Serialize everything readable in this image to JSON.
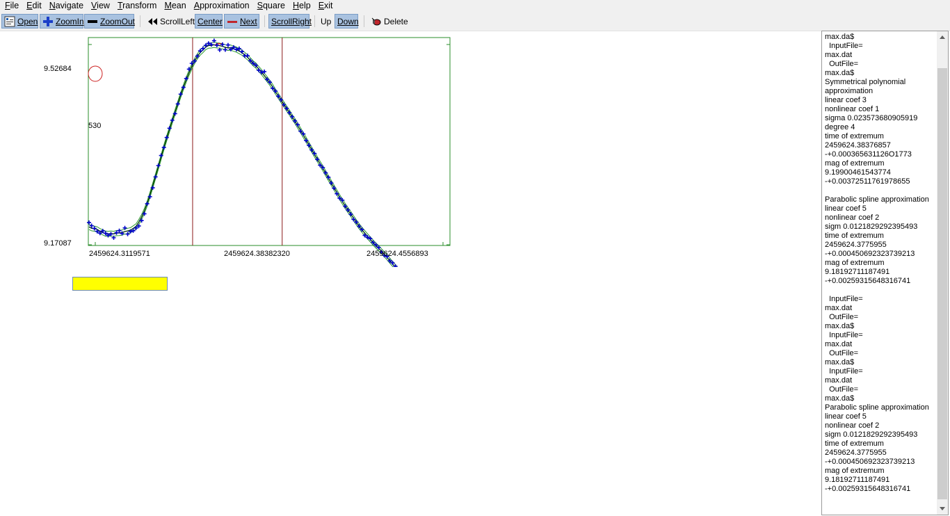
{
  "menu": [
    "File",
    "Edit",
    "Navigate",
    "View",
    "Transform",
    "Mean",
    "Approximation",
    "Square",
    "Help",
    "Exit"
  ],
  "toolbar": {
    "open": "Open",
    "zoom_in": "ZoomIn",
    "zoom_out": "ZoomOut",
    "scroll_left": "ScrollLeft",
    "center": "Center",
    "next": "Next",
    "scroll_right": "ScrollRight",
    "up": "Up",
    "down": "Down",
    "delete": "Delete"
  },
  "chart_data": {
    "type": "scatter",
    "y_tick_labels": [
      "9.52684",
      "530",
      "9.17087"
    ],
    "x_tick_labels": [
      "2459624.3119571",
      "2459624.38382320",
      "2459624.4556893"
    ],
    "xlim": [
      2459624.3119571,
      2459624.4935
    ],
    "ylim": [
      9.17087,
      9.53515
    ],
    "y_inverted": true,
    "limit_lines_x": [
      2459624.36431,
      2459624.40927
    ],
    "extremum": {
      "x": 2459624.3775955,
      "y": 9.18192711187491
    },
    "series": [
      {
        "marker": "+",
        "color": "#0000cc",
        "x": [
          2459624.3123,
          2459624.3136,
          2459624.315,
          2459624.3164,
          2459624.3178,
          2459624.3192,
          2459624.3206,
          2459624.3219,
          2459624.3233,
          2459624.3247,
          2459624.3261,
          2459624.3275,
          2459624.3289,
          2459624.3303,
          2459624.3317,
          2459624.3331,
          2459624.3345,
          2459624.3359,
          2459624.3373,
          2459624.3387,
          2459624.3401,
          2459624.3415,
          2459624.3429,
          2459624.3443,
          2459624.3457,
          2459624.3471,
          2459624.3485,
          2459624.3499,
          2459624.3513,
          2459624.3527,
          2459624.3541,
          2459624.3555,
          2459624.3569,
          2459624.3583,
          2459624.3597,
          2459624.3611,
          2459624.3625,
          2459624.3639,
          2459624.3653,
          2459624.3667,
          2459624.3681,
          2459624.3695,
          2459624.3709,
          2459624.3723,
          2459624.3737,
          2459624.3751,
          2459624.3765,
          2459624.3779,
          2459624.3793,
          2459624.3807,
          2459624.3821,
          2459624.3835,
          2459624.3849,
          2459624.3863,
          2459624.3877,
          2459624.3891,
          2459624.3905,
          2459624.3919,
          2459624.3933,
          2459624.3947,
          2459624.3961,
          2459624.3975,
          2459624.3989,
          2459624.4003,
          2459624.4017,
          2459624.4031,
          2459624.4045,
          2459624.4059,
          2459624.4073,
          2459624.4087,
          2459624.4101,
          2459624.4115,
          2459624.4129,
          2459624.4143,
          2459624.4157,
          2459624.4171,
          2459624.4185,
          2459624.4199,
          2459624.4213,
          2459624.4227,
          2459624.4241,
          2459624.4255,
          2459624.4269,
          2459624.4283,
          2459624.4297,
          2459624.4311,
          2459624.4325,
          2459624.4339,
          2459624.4353,
          2459624.4367,
          2459624.4381,
          2459624.4395,
          2459624.4409,
          2459624.4423,
          2459624.4437,
          2459624.4451,
          2459624.4465,
          2459624.4479,
          2459624.4493,
          2459624.4507,
          2459624.4521,
          2459624.4535,
          2459624.4549,
          2459624.4563,
          2459624.4577,
          2459624.4591,
          2459624.4605,
          2459624.4619,
          2459624.4633,
          2459624.4647,
          2459624.4661,
          2459624.4675,
          2459624.4689,
          2459624.4703,
          2459624.4717,
          2459624.4731,
          2459624.4745,
          2459624.4759,
          2459624.4773,
          2459624.4787,
          2459624.4801,
          2459624.4815,
          2459624.4829,
          2459624.4843,
          2459624.4857,
          2459624.4871,
          2459624.4885,
          2459624.4899,
          2459624.4913,
          2459624.4927
        ],
        "y": [
          9.495,
          9.5005,
          9.5052,
          9.5103,
          9.5135,
          9.5097,
          9.5137,
          9.5173,
          9.5152,
          9.5216,
          9.5128,
          9.5092,
          9.514,
          9.5044,
          9.5152,
          9.5105,
          9.5093,
          9.5047,
          9.501,
          9.4915,
          9.4796,
          9.462,
          9.4497,
          9.4341,
          9.415,
          9.3952,
          9.3774,
          9.3635,
          9.3459,
          9.3298,
          9.3157,
          9.3042,
          9.2871,
          9.27,
          9.2581,
          9.2427,
          9.2262,
          9.2161,
          9.2119,
          9.2034,
          9.1943,
          9.1901,
          9.1847,
          9.181,
          9.1832,
          9.1764,
          9.1843,
          9.1925,
          9.1829,
          9.1922,
          9.1839,
          9.1913,
          9.188,
          9.1916,
          9.1902,
          9.1955,
          9.2028,
          9.2027,
          9.2114,
          9.216,
          9.2196,
          9.228,
          9.2318,
          9.2306,
          9.2441,
          9.2492,
          9.2597,
          9.2647,
          9.2736,
          9.2799,
          9.2886,
          9.2951,
          9.3025,
          9.3096,
          9.317,
          9.3236,
          9.3348,
          9.3397,
          9.3513,
          9.3596,
          9.3677,
          9.374,
          9.3843,
          9.3945,
          9.3987,
          9.4079,
          9.4157,
          9.4257,
          9.4347,
          9.4444,
          9.4522,
          9.4558,
          9.4664,
          9.473,
          9.4804,
          9.4893,
          9.4942,
          9.5014,
          9.5072,
          9.5174,
          9.5206,
          9.5232,
          9.5298,
          9.5342,
          9.5387,
          9.5466,
          9.5522,
          9.5544,
          9.562,
          9.5657,
          9.5715,
          9.58,
          9.586,
          9.5925,
          9.5968,
          9.6045,
          9.6081,
          9.6131,
          9.6207,
          9.6281,
          9.6315,
          9.6404,
          9.6435,
          9.6511,
          9.6574,
          9.6627,
          9.6664,
          9.6743,
          9.6785,
          9.6852
        ]
      }
    ],
    "fit_curves": [
      {
        "name": "Symmetrical polynomial approximation",
        "color": "#006600",
        "extremum_x": 2459624.38376857,
        "extremum_y": 9.19900461543774
      },
      {
        "name": "Parabolic spline approximation",
        "color": "#008000",
        "extremum_x": 2459624.3775955,
        "extremum_y": 9.18192711187491
      }
    ]
  },
  "input": {
    "value": ""
  },
  "log_lines": [
    "max.da$",
    "  InputFile=",
    "max.dat",
    "  OutFile=",
    "max.da$",
    "Symmetrical polynomial",
    "approximation",
    "linear coef 3",
    "nonlinear coef 1",
    "sigma 0.023573680905919",
    "degree 4",
    "time of extremum",
    "2459624.38376857",
    "-+0.000365631126O1773",
    "mag of extremum",
    "9.19900461543774",
    "-+0.00372511761978655",
    "",
    "Parabolic spline approximation",
    "linear coef 5",
    "nonlinear coef 2",
    "sigm 0.0121829292395493",
    "time of extremum",
    "2459624.3775955",
    "-+0.000450692323739213",
    "mag of extremum",
    "9.18192711187491",
    "-+0.00259315648316741",
    "",
    "  InputFile=",
    "max.dat",
    "  OutFile=",
    "max.da$",
    "  InputFile=",
    "max.dat",
    "  OutFile=",
    "max.da$",
    "  InputFile=",
    "max.dat",
    "  OutFile=",
    "max.da$",
    "Parabolic spline approximation",
    "linear coef 5",
    "nonlinear coef 2",
    "sigm 0.0121829292395493",
    "time of extremum",
    "2459624.3775955",
    "-+0.000450692323739213",
    "mag of extremum",
    "9.18192711187491",
    "-+0.00259315648316741"
  ]
}
